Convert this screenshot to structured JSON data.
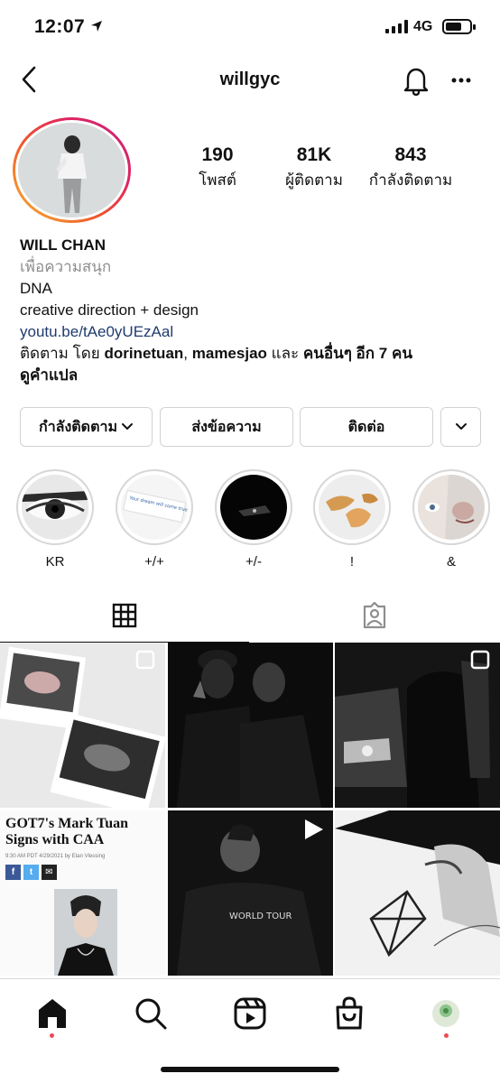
{
  "status_bar": {
    "time": "12:07",
    "network": "4G"
  },
  "header": {
    "username": "willgyc"
  },
  "stats": [
    {
      "value": "190",
      "label": "โพสต์"
    },
    {
      "value": "81K",
      "label": "ผู้ติดตาม"
    },
    {
      "value": "843",
      "label": "กำลังติดตาม"
    }
  ],
  "bio": {
    "name": "WILL CHAN",
    "category": "เพื่อความสนุก",
    "line1": "DNA",
    "line2": "creative direction + design",
    "link": "youtu.be/tAe0yUEzAal",
    "followed_prefix": "ติดตาม โดย ",
    "followed_user1": "dorinetuan",
    "followed_sep": ", ",
    "followed_user2": "mamesjao",
    "followed_and": " และ ",
    "followed_others": "คนอื่นๆ อีก 7 คน",
    "translate": "ดูคำแปล"
  },
  "actions": {
    "following": "กำลังติดตาม",
    "message": "ส่งข้อความ",
    "contact": "ติดต่อ"
  },
  "highlights": [
    {
      "label": "KR"
    },
    {
      "label": "+/+"
    },
    {
      "label": "+/-"
    },
    {
      "label": "!"
    },
    {
      "label": "&"
    }
  ],
  "posts": {
    "news": {
      "title": "GOT7's Mark Tuan Signs with CAA",
      "meta": "9:30 AM PDT 4/29/2021 by Etan Vlessing",
      "share": [
        "f",
        "t",
        "✉"
      ]
    },
    "note_text": "Your dream will come true when you least expect it",
    "tshirt_text": "WORLD TOUR"
  },
  "colors": {
    "accent_link": "#1f3b6e",
    "notification_dot": "#ed4956"
  }
}
